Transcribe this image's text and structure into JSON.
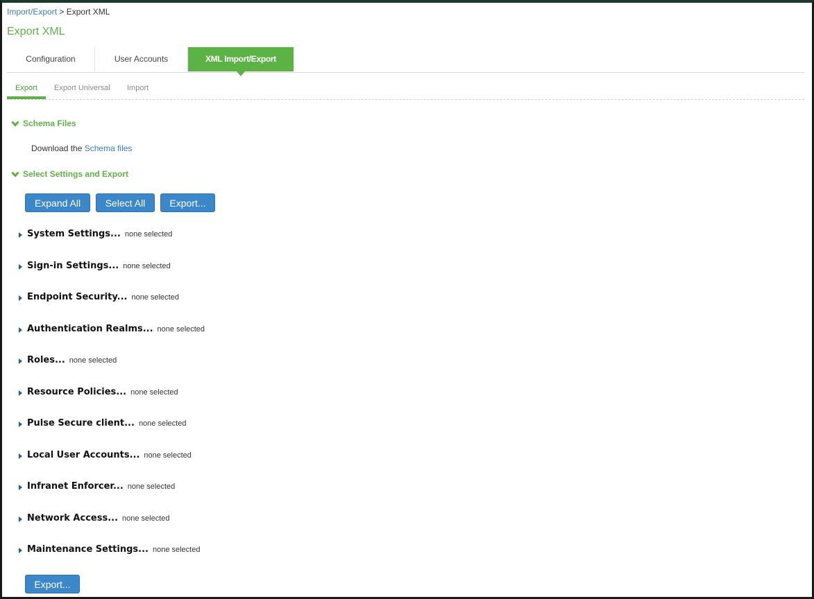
{
  "breadcrumb": {
    "parent": "Import/Export",
    "separator": ">",
    "current": "Export XML"
  },
  "page_title": "Export XML",
  "tabs": [
    {
      "label": "Configuration"
    },
    {
      "label": "User Accounts"
    },
    {
      "label": "XML Import/Export",
      "active": true
    }
  ],
  "subtabs": [
    {
      "label": "Export",
      "active": true
    },
    {
      "label": "Export Universal"
    },
    {
      "label": "Import"
    }
  ],
  "sections": {
    "schema": {
      "title": "Schema Files",
      "text": "Download the",
      "link": "Schema files"
    },
    "settings": {
      "title": "Select Settings and Export"
    }
  },
  "buttons": {
    "expand_all": "Expand All",
    "select_all": "Select All",
    "export_top": "Export...",
    "export_bottom": "Export..."
  },
  "tree_items": [
    {
      "label": "System Settings...",
      "status": "none selected"
    },
    {
      "label": "Sign-in Settings...",
      "status": "none selected"
    },
    {
      "label": "Endpoint Security...",
      "status": "none selected"
    },
    {
      "label": "Authentication Realms...",
      "status": "none selected"
    },
    {
      "label": "Roles...",
      "status": "none selected"
    },
    {
      "label": "Resource Policies...",
      "status": "none selected"
    },
    {
      "label": "Pulse Secure client...",
      "status": "none selected"
    },
    {
      "label": "Local User Accounts...",
      "status": "none selected"
    },
    {
      "label": "Infranet Enforcer...",
      "status": "none selected"
    },
    {
      "label": "Network Access...",
      "status": "none selected"
    },
    {
      "label": "Maintenance Settings...",
      "status": "none selected"
    }
  ],
  "colors": {
    "accent": "#5db246",
    "link": "#3a7cc0",
    "button": "#3b87c9",
    "arrow": "#1f5fa0"
  },
  "icons": {
    "section": "chevron-down-icon",
    "tree": "caret-right-icon"
  }
}
